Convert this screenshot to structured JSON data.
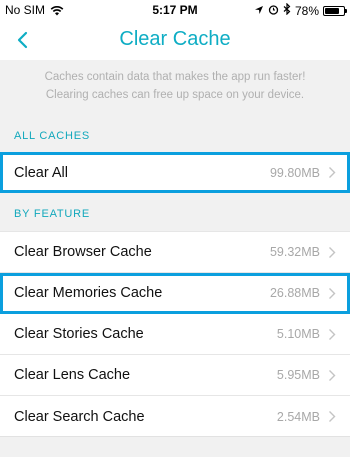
{
  "status_bar": {
    "carrier": "No SIM",
    "time": "5:17 PM",
    "battery_text": "78%",
    "battery_level": 0.78
  },
  "nav": {
    "title": "Clear Cache"
  },
  "description": {
    "line1": "Caches contain data that makes the app run faster!",
    "line2": "Clearing caches can free up space on your device."
  },
  "all_caches": {
    "header": "ALL CACHES",
    "items": [
      {
        "label": "Clear All",
        "size": "99.80MB"
      }
    ]
  },
  "by_feature": {
    "header": "BY FEATURE",
    "items": [
      {
        "label": "Clear Browser Cache",
        "size": "59.32MB"
      },
      {
        "label": "Clear Memories Cache",
        "size": "26.88MB"
      },
      {
        "label": "Clear Stories Cache",
        "size": "5.10MB"
      },
      {
        "label": "Clear Lens Cache",
        "size": "5.95MB"
      },
      {
        "label": "Clear Search Cache",
        "size": "2.54MB"
      }
    ]
  },
  "colors": {
    "accent": "#0eadc4",
    "highlight": "#0b9fde"
  }
}
